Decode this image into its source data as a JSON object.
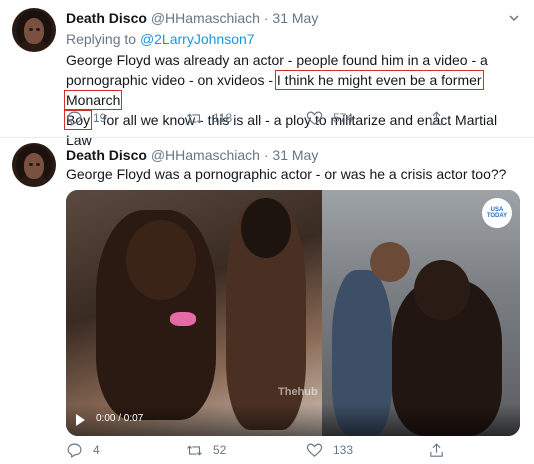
{
  "tweets": [
    {
      "name": "Death Disco",
      "handle": "@HHamaschiach",
      "separator": "·",
      "date": "31 May",
      "replying_prefix": "Replying to ",
      "replying_to": "@2LarryJohnson7",
      "text_part1": "George Floyd was already an actor - people found him in a video - a pornographic video - on xvideos - ",
      "text_highlight1": "I think he might even be a former Monarch",
      "text_highlight2": "Boy",
      "text_part2": " - for all we know - this is all - a ploy to militarize and enact Martial Law",
      "reply_count": "19",
      "retweet_count": "118",
      "like_count": "574"
    },
    {
      "name": "Death Disco",
      "handle": "@HHamaschiach",
      "separator": "·",
      "date": "31 May",
      "text": "George Floyd was a pornographic actor - or was he a crisis actor too??",
      "video_time": "0:00 / 0:07",
      "video_watermark": "Thehub",
      "usa_badge": "USA TODAY",
      "reply_count": "4",
      "retweet_count": "52",
      "like_count": "133"
    }
  ],
  "icons": [
    "reply-icon",
    "retweet-icon",
    "like-icon",
    "share-icon",
    "caret-down-icon",
    "play-icon"
  ],
  "colors": {
    "link": "#1b95e0",
    "muted": "#657786",
    "highlight_box": "#d0302a",
    "divider": "#e6ecf0"
  }
}
